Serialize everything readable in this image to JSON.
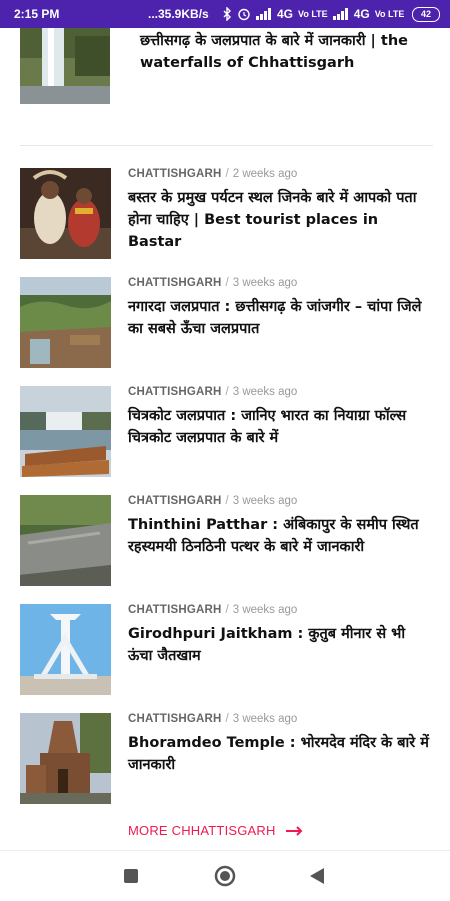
{
  "status_bar": {
    "time": "2:15 PM",
    "speed": "...35.9KB/s",
    "network_left": "4G",
    "network_right": "4G",
    "volte": "Vo LTE",
    "battery": "42"
  },
  "top_article": {
    "title": "छत्तीसगढ़ के जलप्रपात के बारे में जानकारी | the waterfalls of Chhattisgarh"
  },
  "articles": [
    {
      "category": "CHATTISHGARH",
      "time": "2 weeks ago",
      "title": "बस्तर के प्रमुख पर्यटन स्थल जिनके बारे में आपको पता होना चाहिए | Best tourist places in Bastar"
    },
    {
      "category": "CHATTISHGARH",
      "time": "3 weeks ago",
      "title": "नगारदा जलप्रपात : छत्तीसगढ़ के जांजगीर – चांपा जिले का सबसे ऊँचा जलप्रपात"
    },
    {
      "category": "CHATTISHGARH",
      "time": "3 weeks ago",
      "title": "चित्रकोट जलप्रपात : जानिए भारत का नियाग्रा फॉल्स चित्रकोट जलप्रपात के बारे में"
    },
    {
      "category": "CHATTISHGARH",
      "time": "3 weeks ago",
      "title": "Thinthini Patthar : अंबिकापुर के समीप स्थित रहस्यमयी ठिनठिनी पत्थर के बारे में जानकारी"
    },
    {
      "category": "CHATTISHGARH",
      "time": "3 weeks ago",
      "title": "Girodhpuri Jaitkham : कुतुब मीनार से भी ऊंचा जैतखाम"
    },
    {
      "category": "CHATTISHGARH",
      "time": "3 weeks ago",
      "title": "Bhoramdeo Temple : भोरमदेव मंदिर के बारे में जानकारी"
    }
  ],
  "more_link": {
    "label": "MORE CHHATTISGARH",
    "color": "#ef1a4f"
  },
  "colors": {
    "status_bar": "#4d23ad",
    "accent": "#ef1a4f"
  },
  "nav": {
    "recents_icon": "square-icon",
    "home_icon": "circle-icon",
    "back_icon": "triangle-icon"
  }
}
